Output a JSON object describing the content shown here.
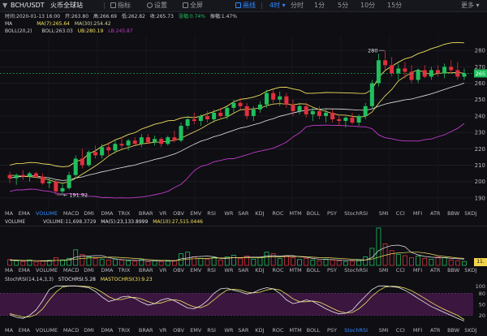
{
  "toolbar": {
    "symbol": "BCH/USDT",
    "exchange": "火币全球站",
    "indicator": "指标",
    "settings": "设置",
    "fullscreen": "全屏",
    "draw": "画线",
    "interval_selected": "4时",
    "intervals": [
      "分时",
      "1分",
      "5分",
      "10分",
      "15分"
    ],
    "more": "更多"
  },
  "ohlc": {
    "time": "时间:2020-01-13 16:00",
    "open": "开:263.80",
    "high": "高:266.69",
    "low": "低:262.82",
    "close": "收:265.73",
    "change": "涨幅:0.74%",
    "amplitude": "振幅:1.47%"
  },
  "ma_line": {
    "label": "MA",
    "ma7": "MA(7):265.64",
    "ma30": "MA(30):254.42"
  },
  "boll_line": {
    "label": "BOLL(20,2)",
    "boll": "BOLL:263.03",
    "ub": "UB:280.19",
    "lb": "LB:245.87"
  },
  "volume_line": {
    "label": "VOLUME",
    "volume": "VOLUME:11,698.3729",
    "ma5": "MA(5):23,133.8999",
    "ma10": "MA(10):27,515.0446"
  },
  "stoch_line": {
    "label": "StochRSI(14,14,3,3)",
    "stoch": "STOCHRSI:5.28",
    "mastoch": "MASTOCHRSI(3):9.23"
  },
  "main_tabs": [
    "MA",
    "EMA",
    "VOLUME",
    "MACD",
    "DMI",
    "DMA",
    "TRIX",
    "BRAR",
    "VR",
    "OBV",
    "EMV",
    "RSI",
    "WR",
    "SAR",
    "KDJ",
    "ROC",
    "MTM",
    "BOLL",
    "PSY",
    "StochRSI",
    "SMI",
    "CCI",
    "MFI",
    "ATR",
    "BBW",
    "SKDJ"
  ],
  "main_tabs_active": "VOLUME",
  "sub_tabs": [
    "MA",
    "EMA",
    "VOLUME",
    "MACD",
    "DMI",
    "DMA",
    "TRIX",
    "BRAR",
    "VR",
    "OBV",
    "EMV",
    "RSI",
    "WR",
    "SAR",
    "KDJ",
    "ROC",
    "MTM",
    "BOLL",
    "PSY",
    "StochRSI",
    "SMI",
    "CCI",
    "MFI",
    "ATR",
    "BBW",
    "SKDJ"
  ],
  "sub_tabs_active": "StochRSI",
  "vol_badge": "11.",
  "colors": {
    "up": "#1fbf5e",
    "down": "#e0303c",
    "ma_yellow": "#f4e25e",
    "boll_white": "#e8e8e8",
    "boll_lb": "#c23bc8",
    "stoch_fill": "#3b1740",
    "accent": "#2f8bff"
  },
  "chart_data": [
    {
      "type": "candlestick",
      "yticks": [
        190,
        200,
        210,
        220,
        230,
        240,
        250,
        260,
        270,
        280
      ],
      "ylim": [
        185,
        288
      ],
      "annotations": [
        {
          "text": "280",
          "value": 280
        },
        {
          "text": "191.92",
          "value": 191.92
        }
      ],
      "last_price": "265",
      "candles": [
        [
          204,
          206,
          199,
          202
        ],
        [
          202,
          205,
          198,
          204
        ],
        [
          204,
          207,
          201,
          203
        ],
        [
          203,
          206,
          200,
          205
        ],
        [
          205,
          206,
          202,
          203
        ],
        [
          203,
          205,
          198,
          199
        ],
        [
          199,
          202,
          196,
          200
        ],
        [
          200,
          201,
          192,
          194
        ],
        [
          194,
          199,
          192,
          196
        ],
        [
          196,
          206,
          195,
          204
        ],
        [
          204,
          216,
          202,
          214
        ],
        [
          214,
          220,
          208,
          210
        ],
        [
          210,
          219,
          209,
          218
        ],
        [
          218,
          222,
          214,
          216
        ],
        [
          216,
          223,
          214,
          221
        ],
        [
          221,
          224,
          216,
          219
        ],
        [
          219,
          225,
          217,
          223
        ],
        [
          223,
          227,
          220,
          222
        ],
        [
          222,
          226,
          219,
          225
        ],
        [
          225,
          227,
          222,
          223
        ],
        [
          223,
          229,
          221,
          227
        ],
        [
          227,
          229,
          223,
          224
        ],
        [
          224,
          228,
          222,
          226
        ],
        [
          226,
          227,
          221,
          223
        ],
        [
          223,
          228,
          222,
          227
        ],
        [
          227,
          231,
          224,
          225
        ],
        [
          225,
          236,
          224,
          234
        ],
        [
          234,
          240,
          232,
          238
        ],
        [
          238,
          242,
          235,
          237
        ],
        [
          237,
          241,
          234,
          240
        ],
        [
          240,
          243,
          236,
          238
        ],
        [
          238,
          244,
          236,
          242
        ],
        [
          242,
          245,
          239,
          240
        ],
        [
          240,
          246,
          238,
          245
        ],
        [
          245,
          250,
          242,
          248
        ],
        [
          248,
          251,
          244,
          246
        ],
        [
          246,
          248,
          238,
          240
        ],
        [
          240,
          246,
          237,
          244
        ],
        [
          244,
          249,
          242,
          247
        ],
        [
          247,
          256,
          245,
          254
        ],
        [
          254,
          256,
          248,
          250
        ],
        [
          250,
          255,
          246,
          252
        ],
        [
          252,
          254,
          245,
          247
        ],
        [
          247,
          250,
          240,
          243
        ],
        [
          243,
          248,
          241,
          246
        ],
        [
          246,
          248,
          239,
          241
        ],
        [
          241,
          245,
          237,
          243
        ],
        [
          243,
          246,
          238,
          240
        ],
        [
          240,
          244,
          236,
          242
        ],
        [
          242,
          244,
          236,
          238
        ],
        [
          238,
          241,
          234,
          237
        ],
        [
          237,
          240,
          233,
          239
        ],
        [
          239,
          242,
          235,
          236
        ],
        [
          236,
          241,
          234,
          240
        ],
        [
          240,
          248,
          238,
          246
        ],
        [
          246,
          262,
          244,
          260
        ],
        [
          260,
          278,
          258,
          274
        ],
        [
          274,
          280,
          268,
          271
        ],
        [
          271,
          276,
          264,
          266
        ],
        [
          266,
          272,
          262,
          269
        ],
        [
          269,
          273,
          263,
          267
        ],
        [
          267,
          271,
          260,
          262
        ],
        [
          262,
          269,
          260,
          268
        ],
        [
          268,
          271,
          263,
          264
        ],
        [
          264,
          270,
          262,
          268
        ],
        [
          268,
          271,
          264,
          266
        ],
        [
          266,
          272,
          263,
          270
        ],
        [
          270,
          274,
          266,
          268
        ],
        [
          268,
          273,
          262,
          264
        ],
        [
          264,
          269,
          262,
          266
        ]
      ],
      "ma7": [
        204,
        203.5,
        203.2,
        203,
        202.6,
        202,
        201,
        199.8,
        199,
        199.8,
        202,
        204.5,
        207,
        209.5,
        212.4,
        215.6,
        218,
        219.6,
        220.8,
        222,
        223,
        223.5,
        224,
        224.1,
        224.6,
        225.1,
        226.4,
        228.4,
        230.3,
        232.2,
        234.6,
        236.8,
        238.2,
        239.4,
        241.7,
        243.8,
        244.1,
        244.4,
        244.7,
        246.3,
        247.3,
        247.6,
        247.2,
        246.8,
        247.5,
        247.3,
        245.4,
        243.9,
        242.8,
        241.5,
        240.6,
        240.5,
        239.8,
        239.3,
        239.7,
        242.4,
        247.7,
        252.4,
        256.2,
        261.4,
        264.1,
        266.6,
        268.2,
        266.5,
        265.2,
        265.9,
        266.4,
        266.3,
        266.6,
        266
      ]
    },
    {
      "type": "bar",
      "name": "volume",
      "ylim": [
        0,
        100
      ],
      "values": [
        15,
        12,
        10,
        14,
        9,
        11,
        13,
        20,
        14,
        18,
        40,
        28,
        22,
        18,
        16,
        14,
        15,
        13,
        12,
        11,
        15,
        10,
        12,
        10,
        11,
        12,
        30,
        34,
        22,
        18,
        16,
        20,
        14,
        22,
        26,
        18,
        24,
        16,
        20,
        34,
        30,
        18,
        24,
        20,
        15,
        18,
        14,
        12,
        16,
        14,
        12,
        10,
        11,
        14,
        22,
        44,
        96,
        55,
        38,
        28,
        25,
        20,
        24,
        18,
        16,
        22,
        20,
        14,
        12,
        10
      ],
      "ma5": [
        13,
        13,
        12,
        12,
        12,
        11,
        11,
        13,
        13,
        15,
        21,
        24,
        24,
        25,
        25,
        20,
        17,
        15,
        14,
        13,
        13,
        12,
        12,
        12,
        12,
        11,
        17,
        19,
        22,
        23,
        24,
        22,
        18,
        18,
        20,
        20,
        21,
        21,
        21,
        24,
        25,
        24,
        25,
        25,
        22,
        21,
        18,
        16,
        15,
        15,
        14,
        13,
        13,
        12,
        14,
        20,
        38,
        46,
        51,
        52,
        48,
        33,
        27,
        23,
        21,
        20,
        20,
        18,
        17,
        16
      ],
      "ma10": [
        14,
        14,
        13,
        13,
        12,
        12,
        12,
        13,
        13,
        14,
        16,
        18,
        19,
        20,
        20,
        21,
        21,
        20,
        19,
        18,
        17,
        15,
        14,
        13,
        13,
        12,
        14,
        16,
        17,
        18,
        18,
        19,
        19,
        19,
        20,
        20,
        20,
        20,
        20,
        21,
        22,
        22,
        23,
        23,
        23,
        22,
        21,
        20,
        20,
        19,
        18,
        17,
        16,
        15,
        14,
        16,
        21,
        26,
        30,
        32,
        33,
        34,
        34,
        32,
        29,
        25,
        23,
        21,
        19,
        18
      ]
    },
    {
      "type": "line",
      "name": "stochrsi",
      "yticks": [
        20,
        50,
        80,
        100
      ],
      "ylim": [
        -5,
        105
      ],
      "stoch": [
        22,
        15,
        12,
        20,
        35,
        60,
        90,
        100,
        100,
        100,
        100,
        98,
        95,
        85,
        70,
        58,
        62,
        70,
        72,
        66,
        56,
        48,
        52,
        62,
        66,
        60,
        50,
        40,
        38,
        46,
        60,
        80,
        92,
        94,
        88,
        84,
        78,
        82,
        90,
        95,
        92,
        80,
        62,
        52,
        56,
        62,
        58,
        48,
        38,
        30,
        24,
        26,
        34,
        54,
        72,
        90,
        100,
        100,
        98,
        96,
        88,
        78,
        66,
        55,
        44,
        36,
        28,
        20,
        12,
        5
      ],
      "mastoch": [
        25,
        20,
        16,
        16,
        22,
        38,
        62,
        83,
        97,
        100,
        100,
        99,
        98,
        93,
        83,
        71,
        63,
        63,
        68,
        69,
        65,
        57,
        52,
        54,
        60,
        63,
        59,
        50,
        43,
        41,
        48,
        62,
        77,
        89,
        91,
        89,
        83,
        81,
        83,
        89,
        92,
        89,
        78,
        65,
        57,
        57,
        59,
        56,
        48,
        39,
        31,
        27,
        28,
        38,
        53,
        72,
        87,
        97,
        99,
        98,
        94,
        87,
        77,
        66,
        55,
        45,
        36,
        28,
        20,
        9
      ]
    }
  ]
}
